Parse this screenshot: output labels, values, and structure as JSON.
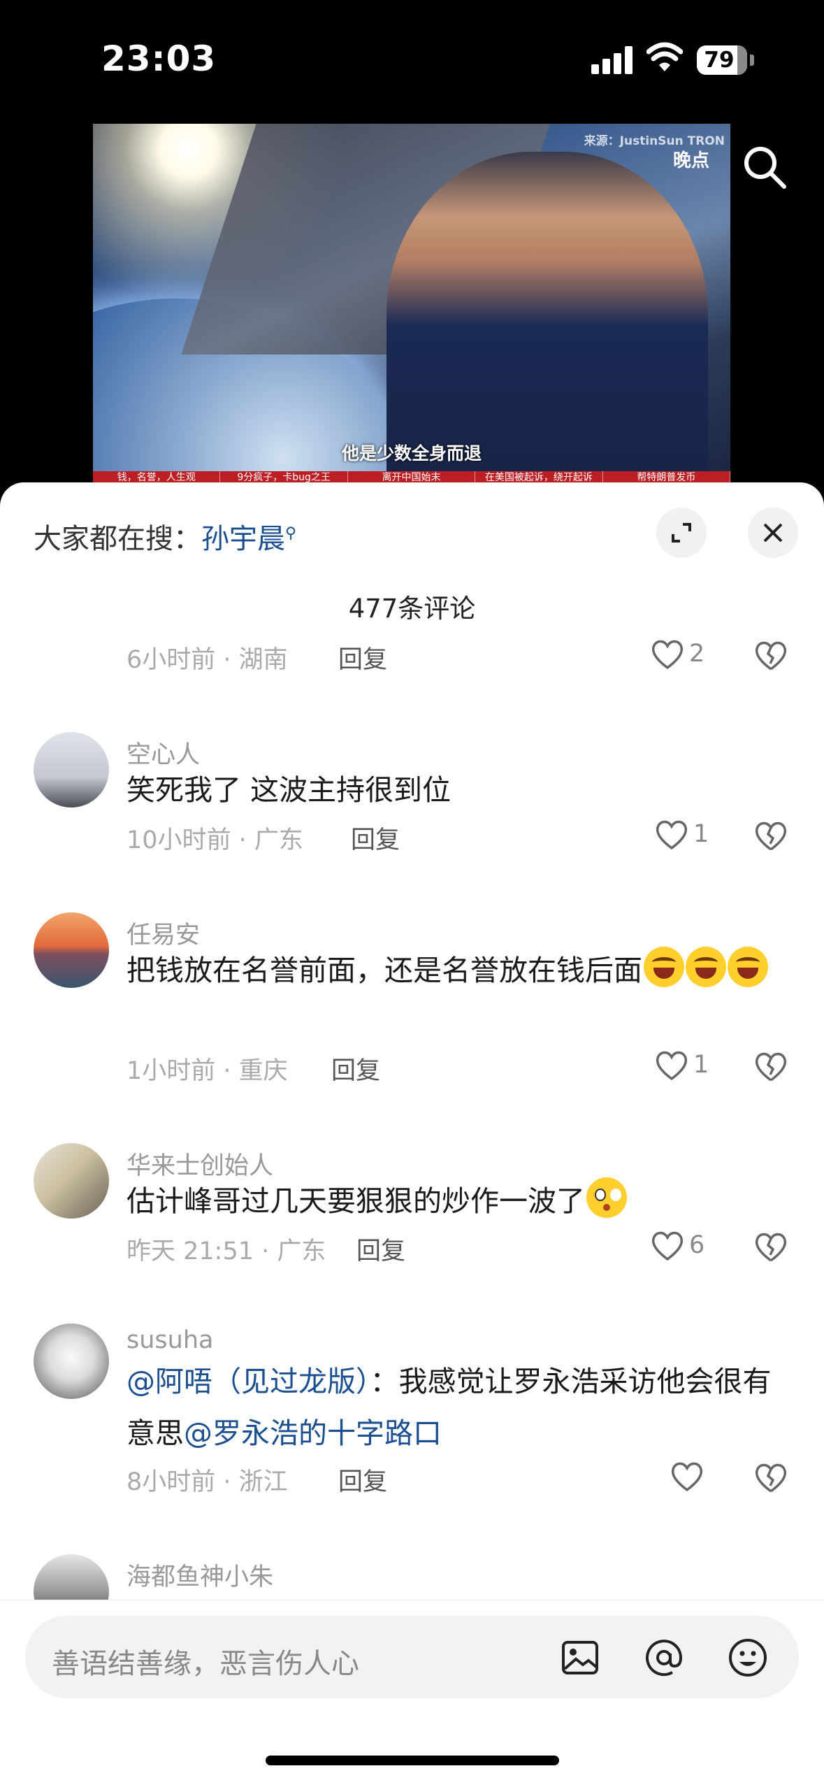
{
  "status_bar": {
    "time": "23:03",
    "battery": "79"
  },
  "video": {
    "source": "来源：JustinSun TRON",
    "brand": "晚点",
    "subtitle": "他是少数全身而退",
    "ticker": [
      "钱，名誉，人生观",
      "9分疯子，卡bug之王",
      "离开中国始末",
      "在美国被起诉，绕开起诉",
      "帮特朗普发币"
    ]
  },
  "panel": {
    "hot_search_prefix": "大家都在搜：",
    "hot_search_keyword": "孙宇晨",
    "comment_count": "477条评论"
  },
  "comments": [
    {
      "time_location": "6小时前 · 湖南",
      "reply_label": "回复",
      "likes": "2"
    },
    {
      "username": "空心人",
      "text": "笑死我了 这波主持很到位",
      "time_location": "10小时前 · 广东",
      "reply_label": "回复",
      "likes": "1"
    },
    {
      "username": "任易安",
      "text": "把钱放在名誉前面，还是名誉放在钱后面",
      "time_location": "1小时前 · 重庆",
      "reply_label": "回复",
      "likes": "1"
    },
    {
      "username": "华来士创始人",
      "text": "估计峰哥过几天要狠狠的炒作一波了",
      "time_location": "昨天 21:51 · 广东",
      "reply_label": "回复",
      "likes": "6"
    },
    {
      "username": "susuha",
      "mention": "@阿唔（见过龙版）",
      "text": "：我感觉让罗永浩采访他会很有意思",
      "mention2": "@罗永浩的十字路口",
      "time_location": "8小时前 · 浙江",
      "reply_label": "回复",
      "likes": ""
    },
    {
      "username": "海都鱼神小朱"
    }
  ],
  "input": {
    "placeholder": "善语结善缘，恶言伤人心"
  },
  "icons": [
    "signal-icon",
    "wifi-icon",
    "battery-icon",
    "search-icon",
    "expand-icon",
    "close-icon",
    "heart-icon",
    "broken-heart-icon",
    "image-icon",
    "at-icon",
    "emoji-icon"
  ]
}
